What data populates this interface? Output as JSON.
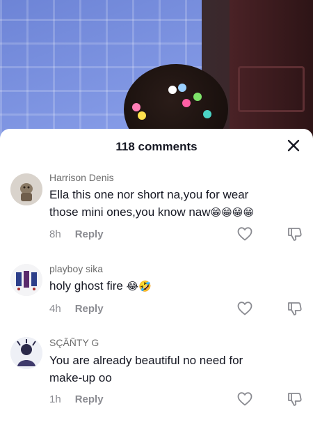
{
  "sheet": {
    "title": "118 comments",
    "close_icon": "close-icon"
  },
  "comments": [
    {
      "username": "Harrison Denis",
      "text_line1": "Ella this one nor short na,you for wear",
      "text_line2": "those mini ones,you know naw",
      "emojis": "😁😁😁😁",
      "time": "8h",
      "reply": "Reply"
    },
    {
      "username": "playboy sika",
      "text_line1": "holy ghost fire",
      "emojis": "😂🤣",
      "time": "4h",
      "reply": "Reply"
    },
    {
      "username": "SÇÃÑTY G",
      "text_line1": "You are already beautiful no need for",
      "text_line2": "make-up oo",
      "time": "1h",
      "reply": "Reply"
    }
  ]
}
